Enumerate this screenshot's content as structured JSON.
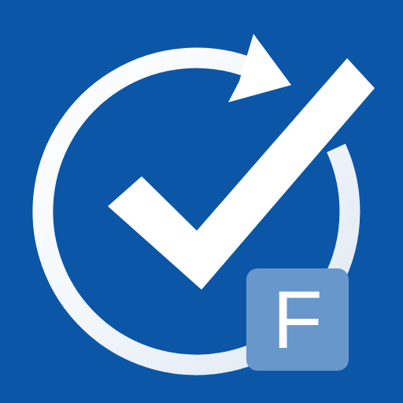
{
  "icon": {
    "background_color": "#0b56a6",
    "mark_color": "#ffffff",
    "badge_color": "#6897cc",
    "symbols": [
      "circular-arrow-icon",
      "checkmark-icon"
    ]
  },
  "badge": {
    "letter": "F"
  }
}
